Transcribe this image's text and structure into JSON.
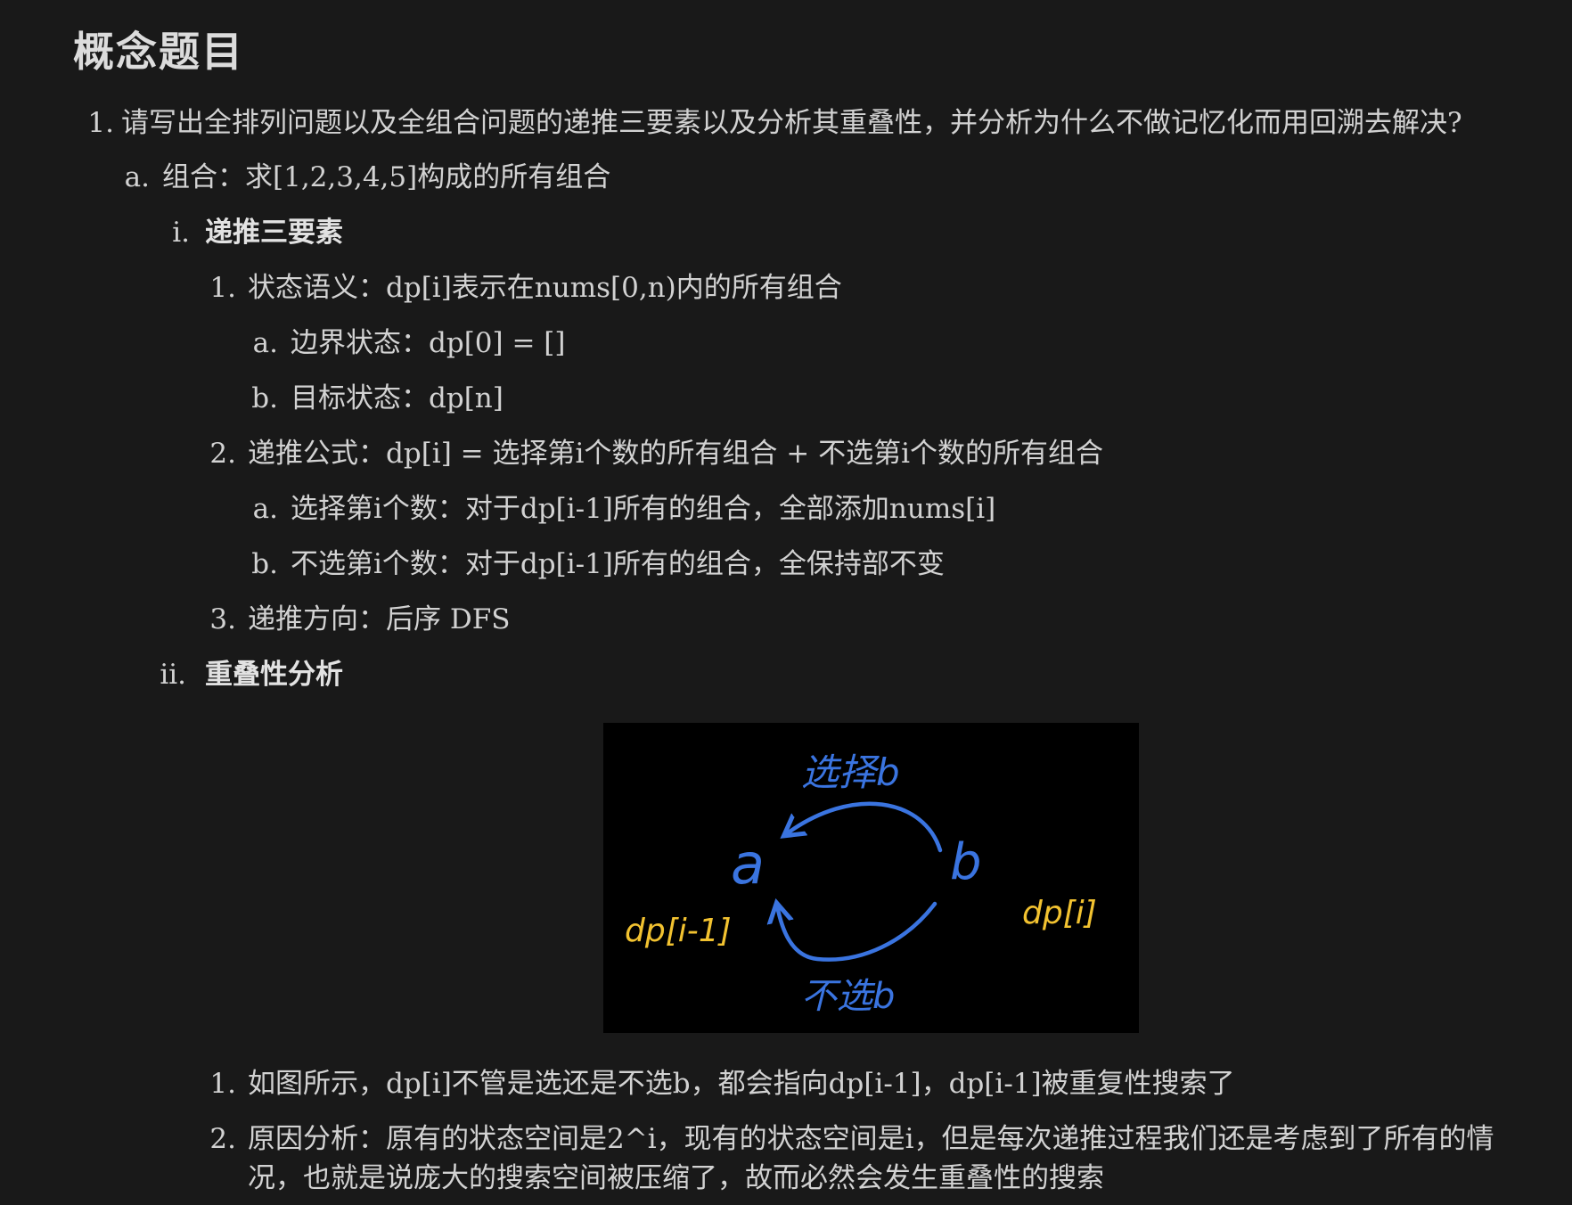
{
  "title": "概念题目",
  "items": [
    {
      "marker": "1.",
      "text": "请写出全排列问题以及全组合问题的递推三要素以及分析其重叠性，并分析为什么不做记忆化而用回溯去解决?"
    },
    {
      "marker": "a.",
      "text": "组合：求[1,2,3,4,5]构成的所有组合"
    },
    {
      "marker": "i.",
      "text": "递推三要素"
    },
    {
      "marker": "1.",
      "text": "状态语义：dp[i]表示在nums[0,n)内的所有组合"
    },
    {
      "marker": "a.",
      "text": "边界状态：dp[0] = []"
    },
    {
      "marker": "b.",
      "text": "目标状态：dp[n]"
    },
    {
      "marker": "2.",
      "text": "递推公式：dp[i] = 选择第i个数的所有组合 + 不选第i个数的所有组合"
    },
    {
      "marker": "a.",
      "text": "选择第i个数：对于dp[i-1]所有的组合，全部添加nums[i]"
    },
    {
      "marker": "b.",
      "text": "不选第i个数：对于dp[i-1]所有的组合，全保持部不变"
    },
    {
      "marker": "3.",
      "text": "递推方向：后序 DFS"
    },
    {
      "marker": "ii.",
      "text": "重叠性分析"
    },
    {
      "marker": "1.",
      "text": "如图所示，dp[i]不管是选还是不选b，都会指向dp[i-1]，dp[i-1]被重复性搜索了"
    },
    {
      "marker": "2.",
      "text": "原因分析：原有的状态空间是2^i，现有的状态空间是i，但是每次递推过程我们还是考虑到了所有的情"
    },
    {
      "text": "况，也就是说庞大的搜索空间被压缩了，故而必然会发生重叠性的搜索"
    }
  ],
  "diagram": {
    "node_a": "a",
    "node_b": "b",
    "top_label": "选择b",
    "bottom_label": "不选b",
    "left_label": "dp[i-1]",
    "right_label": "dp[i]",
    "blue": "#3a74e0",
    "yellow": "#f2c230"
  }
}
